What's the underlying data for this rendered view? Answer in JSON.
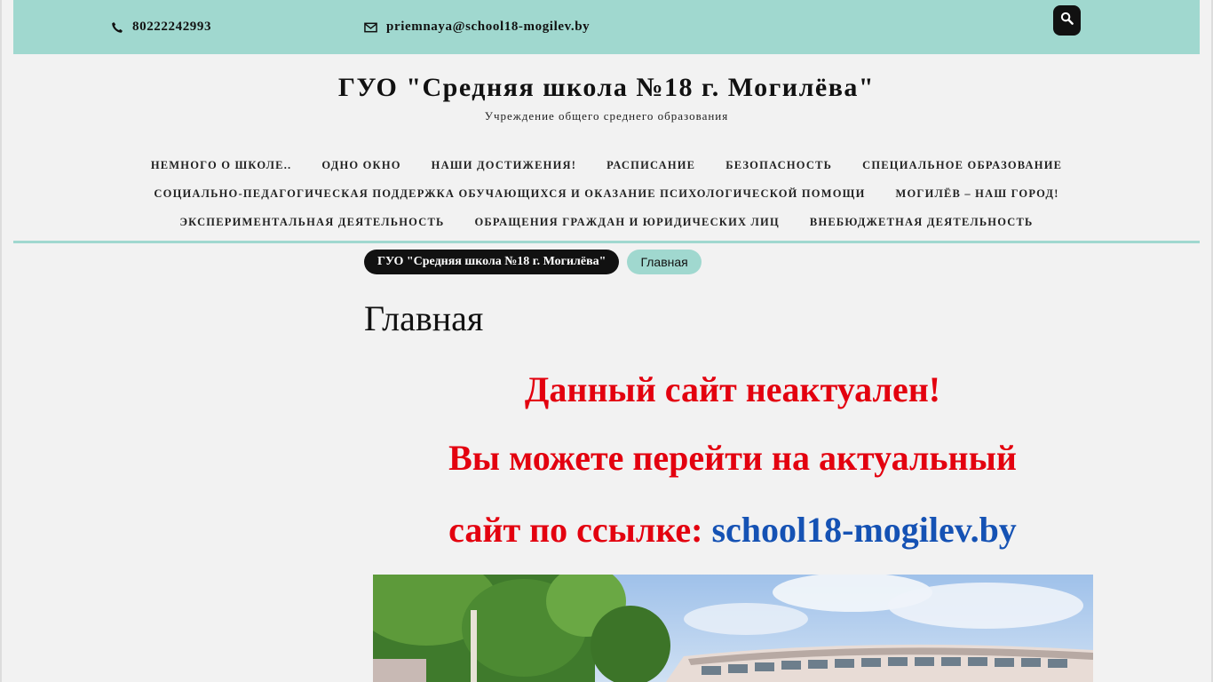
{
  "topbar": {
    "phone": "80222242993",
    "email": "priemnaya@school18-mogilev.by",
    "search_icon": "search-icon",
    "phone_icon": "phone-icon",
    "email_icon": "envelope-icon"
  },
  "header": {
    "title": "ГУО \"Средняя школа №18 г. Могилёва\"",
    "subtitle": "Учреждение общего среднего образования"
  },
  "nav": {
    "row1": [
      "НЕМНОГО О ШКОЛЕ..",
      "ОДНО ОКНО",
      "НАШИ ДОСТИЖЕНИЯ!",
      "РАСПИСАНИЕ",
      "БЕЗОПАСНОСТЬ",
      "СПЕЦИАЛЬНОЕ ОБРАЗОВАНИЕ"
    ],
    "row2": [
      "СОЦИАЛЬНО-ПЕДАГОГИЧЕСКАЯ ПОДДЕРЖКА ОБУЧАЮЩИХСЯ И ОКАЗАНИЕ ПСИХОЛОГИЧЕСКОЙ ПОМОЩИ",
      "МОГИЛЁВ – НАШ ГОРОД!"
    ],
    "row3": [
      "ЭКСПЕРИМЕНТАЛЬНАЯ ДЕЯТЕЛЬНОСТЬ",
      "ОБРАЩЕНИЯ ГРАЖДАН И ЮРИДИЧЕСКИХ ЛИЦ",
      "ВНЕБЮДЖЕТНАЯ ДЕЯТЕЛЬНОСТЬ"
    ]
  },
  "breadcrumb": {
    "home": "ГУО \"Средняя школа №18 г. Могилёва\"",
    "current": "Главная"
  },
  "main": {
    "title": "Главная",
    "notice_line1": "Данный сайт неактуален!",
    "notice_line2": "Вы можете перейти на актуальный",
    "notice_line3_prefix": "сайт по ссылке: ",
    "notice_link": "school18-mogilev.by"
  },
  "colors": {
    "accent": "#a0d8cf",
    "notice_red": "#e3010f",
    "link_blue": "#1552b4",
    "dark": "#111111"
  }
}
